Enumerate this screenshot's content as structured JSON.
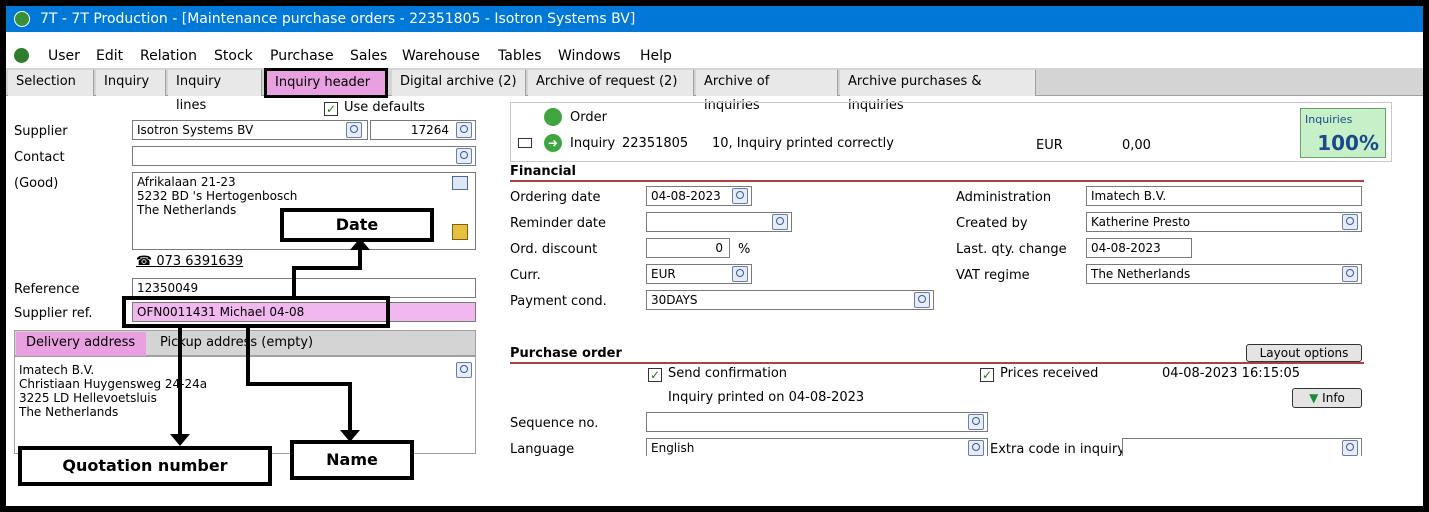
{
  "window": {
    "title": "7T - 7T Production - [Maintenance purchase orders - 22351805 - Isotron Systems BV]"
  },
  "menu": [
    "User",
    "Edit",
    "Relation",
    "Stock",
    "Purchase",
    "Sales",
    "Warehouse",
    "Tables",
    "Windows",
    "Help"
  ],
  "tabs": [
    "Selection",
    "Inquiry",
    "Inquiry lines",
    "Inquiry header",
    "Digital archive (2)",
    "Archive of request (2)",
    "Archive of inquiries",
    "Archive purchases & inquiries"
  ],
  "left": {
    "use_defaults_label": "Use defaults",
    "supplier_label": "Supplier",
    "supplier_value": "Isotron Systems BV",
    "supplier_code": "17264",
    "contact_label": "Contact",
    "good_label": "(Good)",
    "address_lines": [
      "Afrikalaan 21-23",
      "5232 BD  's Hertogenbosch",
      "The Netherlands"
    ],
    "phone": "073 6391639",
    "reference_label": "Reference",
    "reference_value": "12350049",
    "supplier_ref_label": "Supplier ref.",
    "supplier_ref_value": "OFN0011431 Michael 04-08",
    "subtabs": [
      "Delivery address",
      "Pickup address (empty)"
    ],
    "delivery_lines": [
      "Imatech B.V.",
      "Christiaan Huygensweg 24-24a",
      "3225 LD  Hellevoetsluis",
      "The Netherlands"
    ]
  },
  "status": {
    "order_label": "Order",
    "inquiry_label": "Inquiry",
    "inquiry_number": "22351805",
    "inquiry_status": "10, Inquiry printed correctly",
    "currency": "EUR",
    "amount": "0,00",
    "inquiries_label": "Inquiries",
    "inquiries_pct": "100%"
  },
  "financial": {
    "header": "Financial",
    "ordering_date_label": "Ordering date",
    "ordering_date": "04-08-2023",
    "reminder_date_label": "Reminder date",
    "ord_discount_label": "Ord. discount",
    "ord_discount": "0",
    "pct": "%",
    "curr_label": "Curr.",
    "curr": "EUR",
    "payment_cond_label": "Payment cond.",
    "payment_cond": "30DAYS",
    "administration_label": "Administration",
    "administration": "Imatech B.V.",
    "created_by_label": "Created by",
    "created_by": "Katherine Presto",
    "last_qty_label": "Last. qty. change",
    "last_qty": "04-08-2023",
    "vat_label": "VAT regime",
    "vat": "The Netherlands"
  },
  "purchase_order": {
    "header": "Purchase order",
    "layout_options": "Layout options",
    "send_confirmation": "Send confirmation",
    "prices_received": "Prices received",
    "timestamp": "04-08-2023 16:15:05",
    "printed_on": "Inquiry printed on 04-08-2023",
    "info": "Info",
    "sequence_label": "Sequence no.",
    "language_label": "Language",
    "language": "English",
    "extra_code_label": "Extra code in inquiry"
  },
  "callouts": {
    "date": "Date",
    "quotation": "Quotation number",
    "name": "Name"
  }
}
